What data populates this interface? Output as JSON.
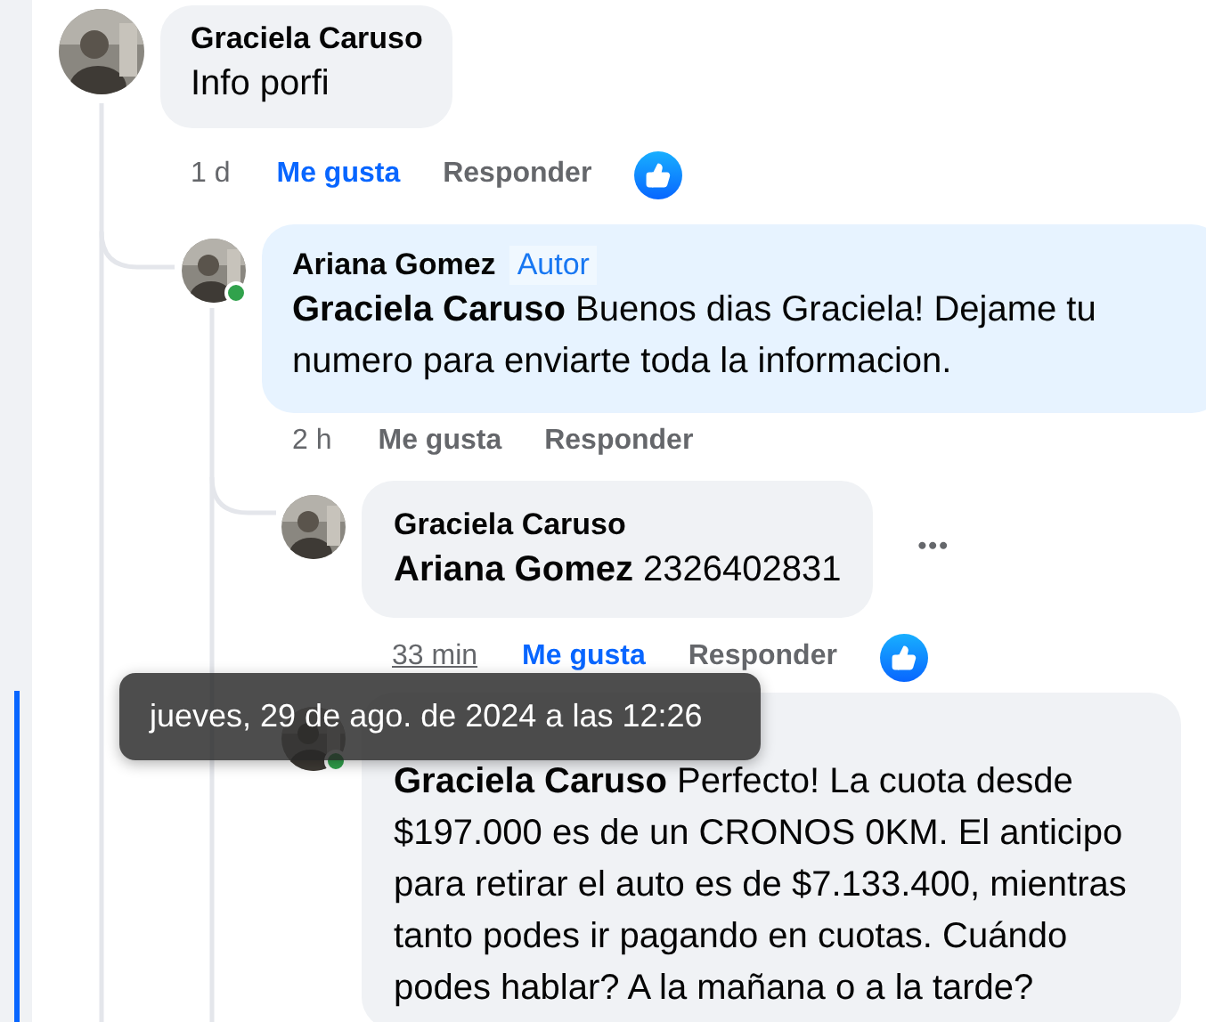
{
  "comments": [
    {
      "author": "Graciela Caruso",
      "online": false,
      "text": "Info porfi",
      "time": "1 d",
      "time_hovered": false,
      "like_label": "Me gusta",
      "liked": true,
      "reply_label": "Responder",
      "reaction": true,
      "menu": false,
      "children": [
        {
          "author": "Ariana Gomez",
          "badge": "Autor",
          "online": true,
          "mention": "Graciela Caruso",
          "text": "Buenos dias Graciela! Dejame tu numero para enviarte toda la informacion.",
          "time": "2 h",
          "time_hovered": false,
          "like_label": "Me gusta",
          "liked": false,
          "reply_label": "Responder",
          "reaction": false,
          "menu": false,
          "children": [
            {
              "author": "Graciela Caruso",
              "online": false,
              "mention": "Ariana Gomez",
              "text": "2326402831",
              "time": "33 min",
              "time_hovered": true,
              "like_label": "Me gusta",
              "liked": true,
              "reply_label": "Responder",
              "reaction": true,
              "menu": true,
              "menu_label": "•••"
            },
            {
              "online": true,
              "mention": "Graciela Caruso",
              "text": "Perfecto! La cuota desde $197.000 es de un CRONOS 0KM. El anticipo para retirar el auto es de $7.133.400, mientras tanto podes ir pagando en cuotas. Cuándo podes hablar? A la mañana o a la tarde?"
            }
          ]
        }
      ]
    }
  ],
  "tooltip": {
    "text": "jueves, 29 de ago. de 2024 a las 12:26"
  }
}
